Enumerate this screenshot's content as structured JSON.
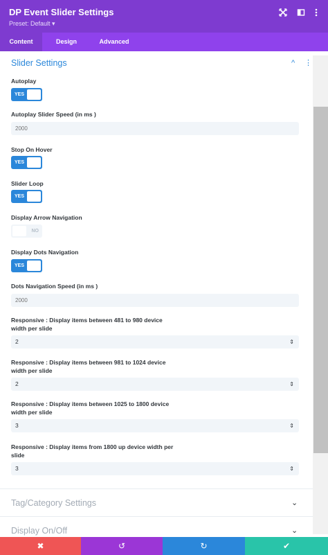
{
  "header": {
    "title": "DP Event Slider Settings",
    "preset": "Preset: Default ",
    "preset_caret": "▾",
    "icons": [
      "expand-icon",
      "split-view-icon",
      "more-vertical-icon"
    ]
  },
  "tabs": [
    {
      "label": "Content",
      "active": true
    },
    {
      "label": "Design",
      "active": false
    },
    {
      "label": "Advanced",
      "active": false
    }
  ],
  "section": {
    "title": "Slider Settings",
    "chevron": "^",
    "more": "⋮"
  },
  "fields": {
    "autoplay": {
      "label": "Autoplay",
      "value": "YES"
    },
    "autoplay_speed": {
      "label": "Autoplay Slider Speed (in ms )",
      "placeholder": "2000"
    },
    "stop_on_hover": {
      "label": "Stop On Hover",
      "value": "YES"
    },
    "slider_loop": {
      "label": "Slider Loop",
      "value": "YES"
    },
    "arrow_nav": {
      "label": "Display Arrow Navigation",
      "value": "NO"
    },
    "dots_nav": {
      "label": "Display Dots Navigation",
      "value": "YES"
    },
    "dots_speed": {
      "label": "Dots Navigation Speed (in ms )",
      "placeholder": "2000"
    },
    "resp_481": {
      "label_line1": "Responsive : Display items between 481 to 980 device",
      "label_line2": "width per slide",
      "value": "2"
    },
    "resp_981": {
      "label_line1": "Responsive : Display items between 981 to 1024 device",
      "label_line2": "width per slide",
      "value": "2"
    },
    "resp_1025": {
      "label_line1": "Responsive : Display items between 1025 to 1800 device",
      "label_line2": "width per slide",
      "value": "3"
    },
    "resp_1800": {
      "label_line1": "Responsive : Display items from 1800 up device width per",
      "label_line2": "slide",
      "value": "3"
    }
  },
  "collapsed_sections": [
    {
      "title": "Tag/Category Settings"
    },
    {
      "title": "Display On/Off"
    }
  ],
  "footer": {
    "buttons": [
      {
        "name": "discard",
        "glyph": "✖",
        "color": "#ef5555"
      },
      {
        "name": "undo",
        "glyph": "↺",
        "color": "#9b36d6"
      },
      {
        "name": "redo",
        "glyph": "↻",
        "color": "#2b87da"
      },
      {
        "name": "save",
        "glyph": "✔",
        "color": "#29c4a9"
      }
    ]
  },
  "colors": {
    "header": "#7e3bd0",
    "tabs": "#8f42ec",
    "accent": "#2b87da"
  }
}
